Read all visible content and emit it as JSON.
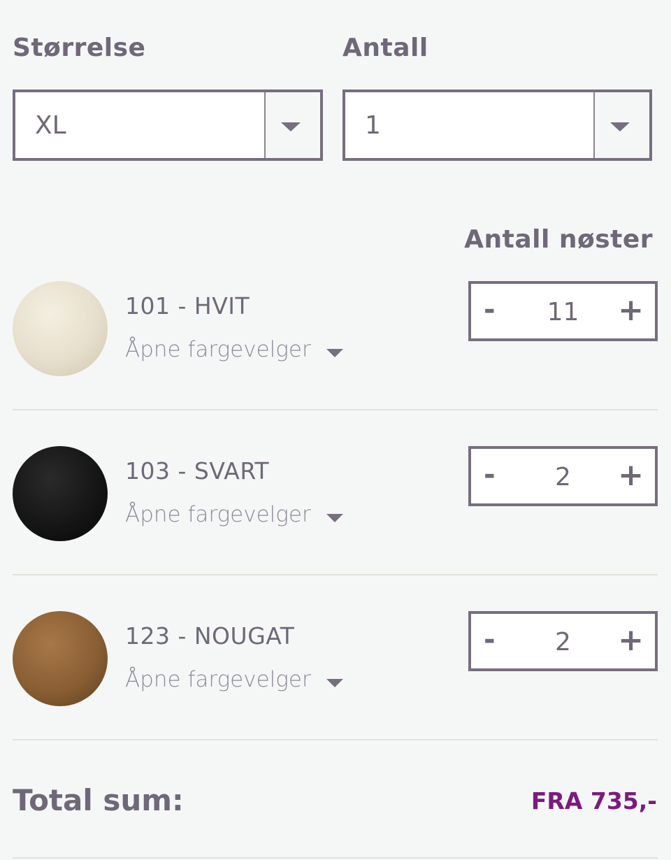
{
  "size": {
    "label": "Størrelse",
    "value": "XL"
  },
  "quantity": {
    "label": "Antall",
    "value": "1"
  },
  "skeins_heading": "Antall nøster",
  "yarns": [
    {
      "name": "101 - HVIT",
      "picker_label": "Åpne fargevelger",
      "count": "11",
      "color": "#e9e3d2"
    },
    {
      "name": "103 - SVART",
      "picker_label": "Åpne fargevelger",
      "count": "2",
      "color": "#121212"
    },
    {
      "name": "123 - NOUGAT",
      "picker_label": "Åpne fargevelger",
      "count": "2",
      "color": "#8a5f34"
    }
  ],
  "stepper": {
    "minus": "-",
    "plus": "+"
  },
  "total": {
    "label": "Total sum:",
    "value": "FRA 735,-"
  },
  "colors": {
    "accent": "#7b1a7f",
    "border": "#776e80",
    "text": "#6f6878"
  }
}
